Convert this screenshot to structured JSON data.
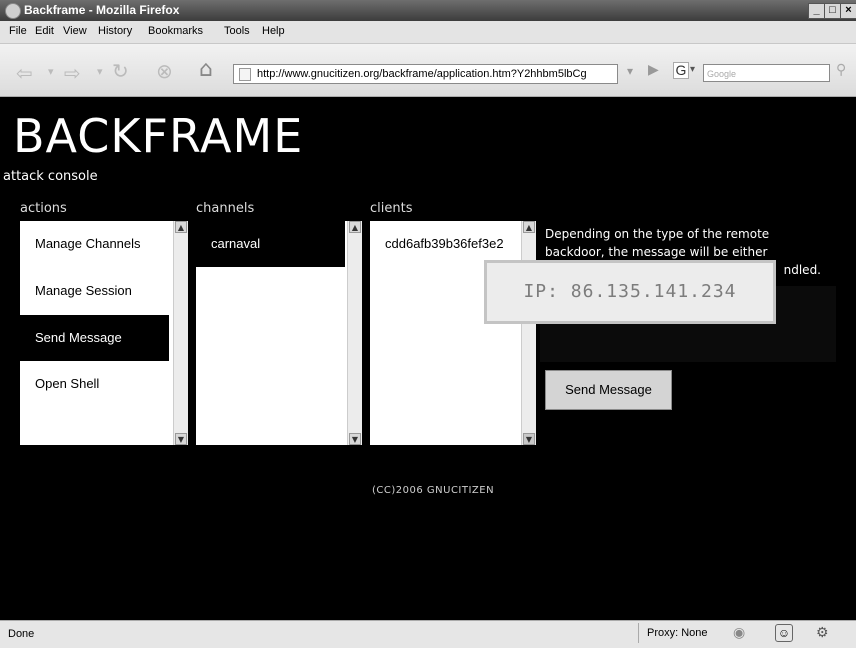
{
  "window": {
    "title": "Backframe - Mozilla Firefox",
    "minimize": "_",
    "maximize": "□",
    "close": "×"
  },
  "menu": {
    "items": [
      "File",
      "Edit",
      "View",
      "History",
      "Bookmarks",
      "Tools",
      "Help"
    ]
  },
  "navbar": {
    "url": "http://www.gnucitizen.org/backframe/application.htm?Y2hhbm5lbCg",
    "search_placeholder": "Google",
    "search_engine_glyph": "G"
  },
  "page": {
    "brand": "BACKFRAME",
    "subtitle": "attack console",
    "actions": {
      "header": "actions",
      "items": [
        "Manage Channels",
        "Manage Session",
        "Send Message",
        "Open Shell"
      ],
      "selected": "Send Message"
    },
    "channels": {
      "header": "channels",
      "items": [
        "carnaval"
      ]
    },
    "clients": {
      "header": "clients",
      "items": [
        "cdd6afb39b36fef3e2"
      ]
    },
    "description_line1": "Depending on the type of the remote",
    "description_line2": "backdoor, the message will be either",
    "description_line3": "ndled.",
    "popup_ip": "IP: 86.135.141.234",
    "send_button": "Send Message",
    "footer": "(CC)2006 GNUCITIZEN"
  },
  "status": {
    "text": "Done",
    "proxy": "Proxy: None"
  },
  "colors": {
    "page_bg": "#000000",
    "selected_item_bg": "#000000",
    "list_bg": "#ffffff",
    "chrome_bg": "#e4e4e4"
  }
}
